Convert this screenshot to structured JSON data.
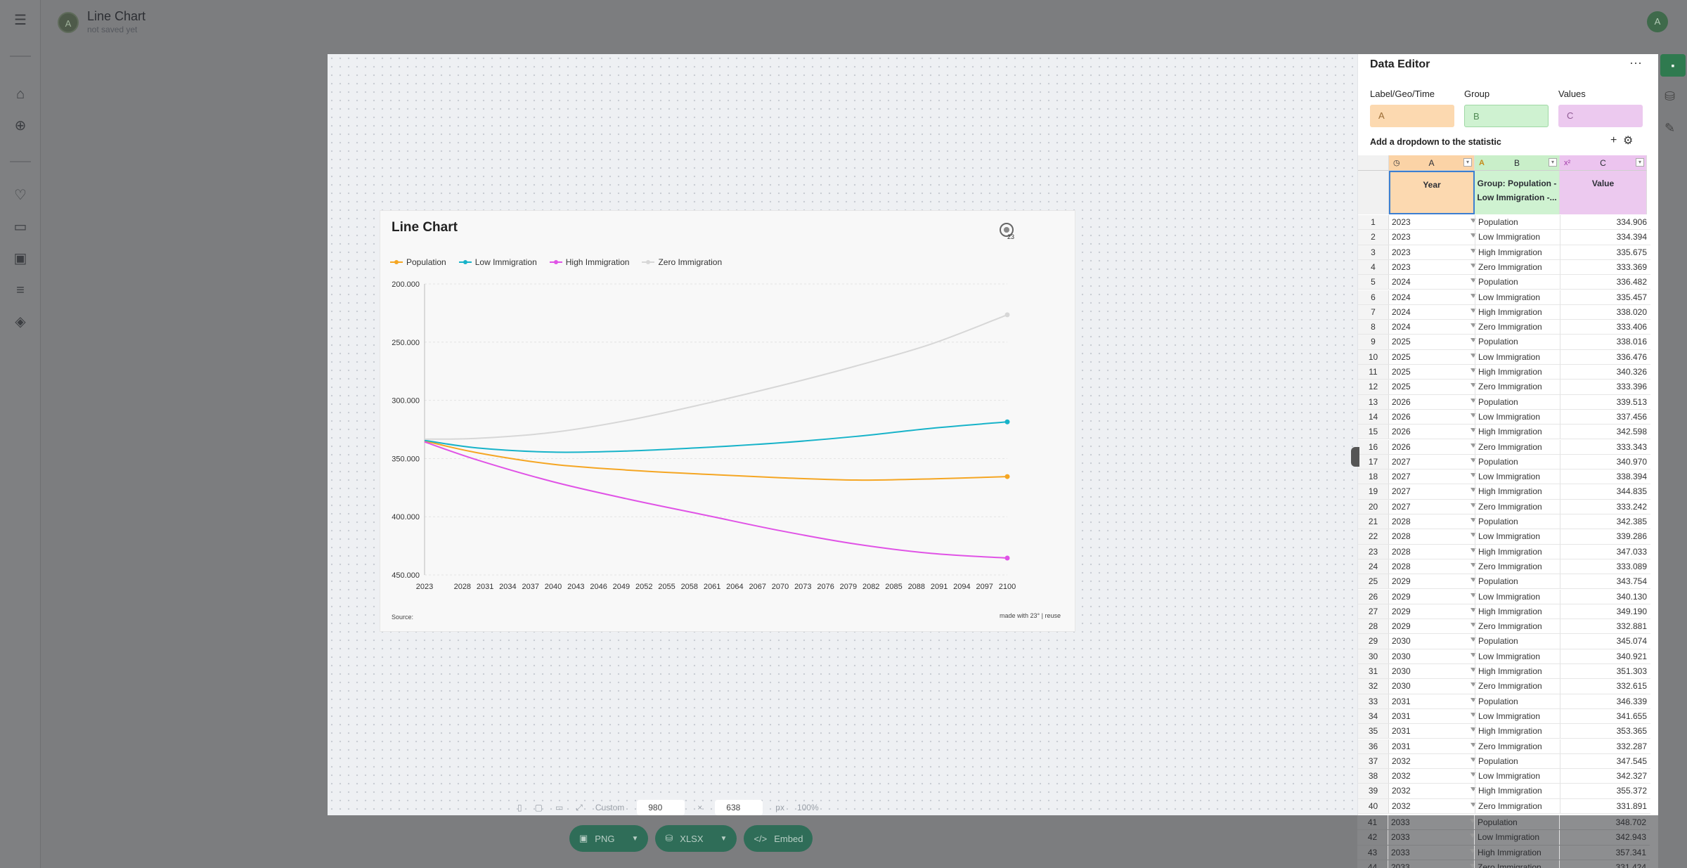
{
  "app": {
    "avatar_letter": "A",
    "title": "Line Chart",
    "subtitle": "not saved yet",
    "user_avatar_letter": "A"
  },
  "chart": {
    "title": "Line Chart",
    "source_label": "Source:",
    "made_with": "made with 23° | reuse"
  },
  "chart_data": {
    "type": "line",
    "title": "Line Chart",
    "xlabel": "",
    "ylabel": "",
    "y_reversed": true,
    "ylim": [
      200000,
      450000
    ],
    "y_ticks": [
      "200.000",
      "250.000",
      "300.000",
      "350.000",
      "400.000",
      "450.000"
    ],
    "x_ticks": [
      "2023",
      "2028",
      "2031",
      "2034",
      "2037",
      "2040",
      "2043",
      "2046",
      "2049",
      "2052",
      "2055",
      "2058",
      "2061",
      "2064",
      "2067",
      "2070",
      "2073",
      "2076",
      "2079",
      "2082",
      "2085",
      "2088",
      "2091",
      "2094",
      "2097",
      "2100"
    ],
    "x": [
      2023,
      2030,
      2040,
      2050,
      2060,
      2070,
      2080,
      2090,
      2100
    ],
    "series": [
      {
        "name": "Population",
        "color": "#f5a623",
        "values": [
          334906,
          345074,
          355000,
          360000,
          363500,
          366500,
          368500,
          367500,
          365500
        ]
      },
      {
        "name": "Low Immigration",
        "color": "#17b3c9",
        "values": [
          334394,
          340921,
          344500,
          343500,
          340500,
          336500,
          331000,
          324000,
          318500
        ]
      },
      {
        "name": "High Immigration",
        "color": "#e053e6",
        "values": [
          335675,
          351303,
          370000,
          385000,
          398500,
          412000,
          423500,
          431500,
          435500
        ]
      },
      {
        "name": "Zero Immigration",
        "color": "#d7d7d7",
        "values": [
          333369,
          332615,
          327500,
          317000,
          303000,
          287500,
          270500,
          251500,
          226500
        ]
      }
    ],
    "legend": "top-left",
    "grid": true
  },
  "footer": {
    "size_mode": "Custom",
    "width": "980",
    "height": "638",
    "unit": "px",
    "zoom": "100%"
  },
  "export": {
    "png": "PNG",
    "xlsx": "XLSX",
    "embed": "Embed"
  },
  "editor": {
    "title": "Data Editor",
    "more": "···",
    "mapping_labels": [
      "Label/Geo/Time",
      "Group",
      "Values"
    ],
    "mapping_values": [
      "A",
      "B",
      "C"
    ],
    "dropdown_label": "Add a dropdown to the statistic",
    "col_letters": [
      "A",
      "B",
      "C"
    ],
    "col_headers": [
      "Year",
      "Group: Population - Low Immigration -...",
      "Value"
    ],
    "rows": [
      [
        "1",
        "2023",
        "Population",
        "334.906"
      ],
      [
        "2",
        "2023",
        "Low Immigration",
        "334.394"
      ],
      [
        "3",
        "2023",
        "High Immigration",
        "335.675"
      ],
      [
        "4",
        "2023",
        "Zero Immigration",
        "333.369"
      ],
      [
        "5",
        "2024",
        "Population",
        "336.482"
      ],
      [
        "6",
        "2024",
        "Low Immigration",
        "335.457"
      ],
      [
        "7",
        "2024",
        "High Immigration",
        "338.020"
      ],
      [
        "8",
        "2024",
        "Zero Immigration",
        "333.406"
      ],
      [
        "9",
        "2025",
        "Population",
        "338.016"
      ],
      [
        "10",
        "2025",
        "Low Immigration",
        "336.476"
      ],
      [
        "11",
        "2025",
        "High Immigration",
        "340.326"
      ],
      [
        "12",
        "2025",
        "Zero Immigration",
        "333.396"
      ],
      [
        "13",
        "2026",
        "Population",
        "339.513"
      ],
      [
        "14",
        "2026",
        "Low Immigration",
        "337.456"
      ],
      [
        "15",
        "2026",
        "High Immigration",
        "342.598"
      ],
      [
        "16",
        "2026",
        "Zero Immigration",
        "333.343"
      ],
      [
        "17",
        "2027",
        "Population",
        "340.970"
      ],
      [
        "18",
        "2027",
        "Low Immigration",
        "338.394"
      ],
      [
        "19",
        "2027",
        "High Immigration",
        "344.835"
      ],
      [
        "20",
        "2027",
        "Zero Immigration",
        "333.242"
      ],
      [
        "21",
        "2028",
        "Population",
        "342.385"
      ],
      [
        "22",
        "2028",
        "Low Immigration",
        "339.286"
      ],
      [
        "23",
        "2028",
        "High Immigration",
        "347.033"
      ],
      [
        "24",
        "2028",
        "Zero Immigration",
        "333.089"
      ],
      [
        "25",
        "2029",
        "Population",
        "343.754"
      ],
      [
        "26",
        "2029",
        "Low Immigration",
        "340.130"
      ],
      [
        "27",
        "2029",
        "High Immigration",
        "349.190"
      ],
      [
        "28",
        "2029",
        "Zero Immigration",
        "332.881"
      ],
      [
        "29",
        "2030",
        "Population",
        "345.074"
      ],
      [
        "30",
        "2030",
        "Low Immigration",
        "340.921"
      ],
      [
        "31",
        "2030",
        "High Immigration",
        "351.303"
      ],
      [
        "32",
        "2030",
        "Zero Immigration",
        "332.615"
      ],
      [
        "33",
        "2031",
        "Population",
        "346.339"
      ],
      [
        "34",
        "2031",
        "Low Immigration",
        "341.655"
      ],
      [
        "35",
        "2031",
        "High Immigration",
        "353.365"
      ],
      [
        "36",
        "2031",
        "Zero Immigration",
        "332.287"
      ],
      [
        "37",
        "2032",
        "Population",
        "347.545"
      ],
      [
        "38",
        "2032",
        "Low Immigration",
        "342.327"
      ],
      [
        "39",
        "2032",
        "High Immigration",
        "355.372"
      ],
      [
        "40",
        "2032",
        "Zero Immigration",
        "331.891"
      ]
    ],
    "rows_below": [
      [
        "41",
        "2033",
        "Population",
        "348.702"
      ],
      [
        "42",
        "2033",
        "Low Immigration",
        "342.943"
      ],
      [
        "43",
        "2033",
        "High Immigration",
        "357.341"
      ],
      [
        "44",
        "2033",
        "Zero Immigration",
        "331.424"
      ]
    ]
  }
}
